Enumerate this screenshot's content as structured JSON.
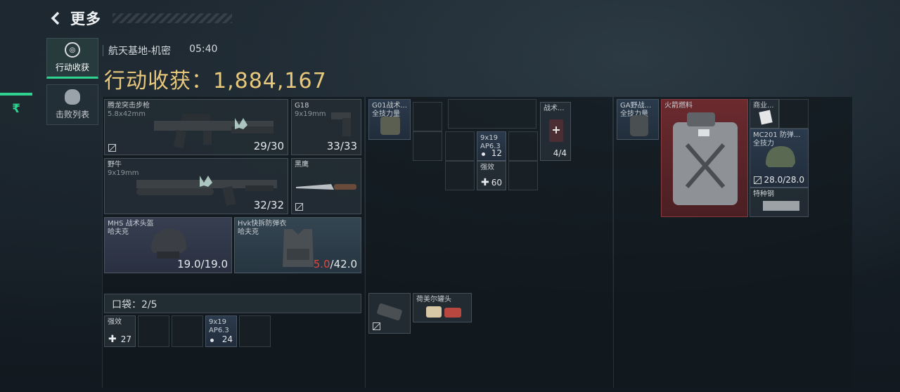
{
  "header": {
    "back_icon": "chevron-left-icon",
    "title": "更多"
  },
  "side_tabs": [
    {
      "label": "行动收获",
      "icon": "target-icon",
      "active": true
    },
    {
      "label": "击败列表",
      "icon": "skull-icon",
      "active": false
    }
  ],
  "currency_symbol": "₹",
  "map_info": {
    "map": "航天基地-机密",
    "time": "05:40"
  },
  "haul": {
    "label": "行动收获：",
    "value": "1,884,167"
  },
  "loadout": {
    "primary": {
      "name": "腾龙突击步枪",
      "ammo": "5.8x42mm",
      "count": "29/30"
    },
    "sidearm": {
      "name": "G18",
      "ammo": "9x19mm",
      "count": "33/33"
    },
    "secondary": {
      "name": "野牛",
      "ammo": "9x19mm",
      "count": "32/32"
    },
    "melee": {
      "name": "黑鹰"
    },
    "helmet": {
      "name": "MHS 战术头盔",
      "brand": "哈夫克",
      "durability": "19.0/19.0"
    },
    "armor": {
      "name": "Hvk快拆防弹衣",
      "brand": "哈夫克",
      "durability_current": "5.0",
      "durability_max": "/42.0"
    }
  },
  "pocket": {
    "label": "口袋：2/5",
    "items": [
      {
        "name": "强效",
        "count": "27"
      },
      {
        "name": "9x19",
        "sub": "AP6.3",
        "count": "24"
      }
    ]
  },
  "rig": {
    "name": "G01战术...",
    "sub": "全技力量",
    "items": [
      {
        "name": "9x19",
        "sub": "AP6.3",
        "count": "12"
      },
      {
        "name": "强效",
        "count": "60"
      },
      {
        "name": "战术...",
        "count": "4/4"
      }
    ],
    "case_items": [
      {
        "name": "荷美尔罐头"
      }
    ]
  },
  "backpack": {
    "name": "GA野战...",
    "sub": "全技力量",
    "items": [
      {
        "name": "火箭燃料"
      },
      {
        "name": "商业..."
      },
      {
        "name": "MC201 防弹...",
        "sub": "全技力",
        "count": "28.0/28.0"
      },
      {
        "name": "特种钢"
      }
    ]
  }
}
